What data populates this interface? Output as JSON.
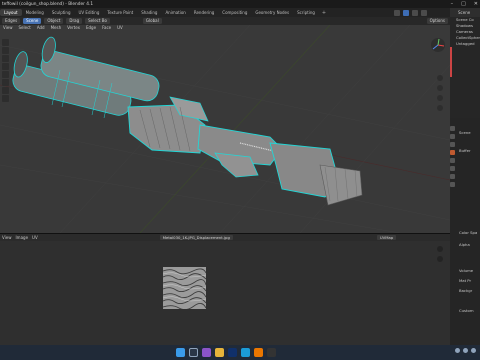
{
  "window": {
    "title": "teffowil (coilgun_shop.blend) - Blender 4.1"
  },
  "workspace_tabs": [
    "Layout",
    "Modeling",
    "Sculpting",
    "UV Editing",
    "Texture Paint",
    "Shading",
    "Animation",
    "Rendering",
    "Compositing",
    "Geometry Nodes",
    "Scripting"
  ],
  "active_tab": "Layout",
  "viewport_header": {
    "mode": "Edges",
    "buttons": [
      "Scene",
      "Object"
    ],
    "drag_label": "Drag",
    "select_box": "Select Bo",
    "transform": "Global",
    "menus": [
      "View",
      "Select",
      "Add",
      "Mesh",
      "Vertex",
      "Edge",
      "Face",
      "UV"
    ],
    "options_label": "Options"
  },
  "outliner": {
    "header": "Scene",
    "rows": [
      "Scene Co",
      "Shadows",
      "Cameras",
      "CollectSphere",
      "Untagged",
      "",
      "",
      "",
      "",
      ""
    ]
  },
  "image_editor": {
    "menus": [
      "View",
      "Image",
      "UV"
    ],
    "image_name": "Metal030_1K-JPG_Displacement.jpg",
    "channel": "UVMap"
  },
  "properties": {
    "labels": [
      "Scene",
      "Buffer",
      "Color Spa",
      "Alpha",
      "Volume",
      "Mat Pr",
      "Backgr",
      "Custom"
    ]
  },
  "colors": {
    "wire_cyan": "#22d6d6",
    "mesh_grey": "#8d8d8d",
    "accent_blue": "#4772b3",
    "viewport_bg": "#393939"
  },
  "icons": {
    "start": "windows-start-icon",
    "search": "search-icon",
    "nav": "navigation-gizmo-icon"
  }
}
